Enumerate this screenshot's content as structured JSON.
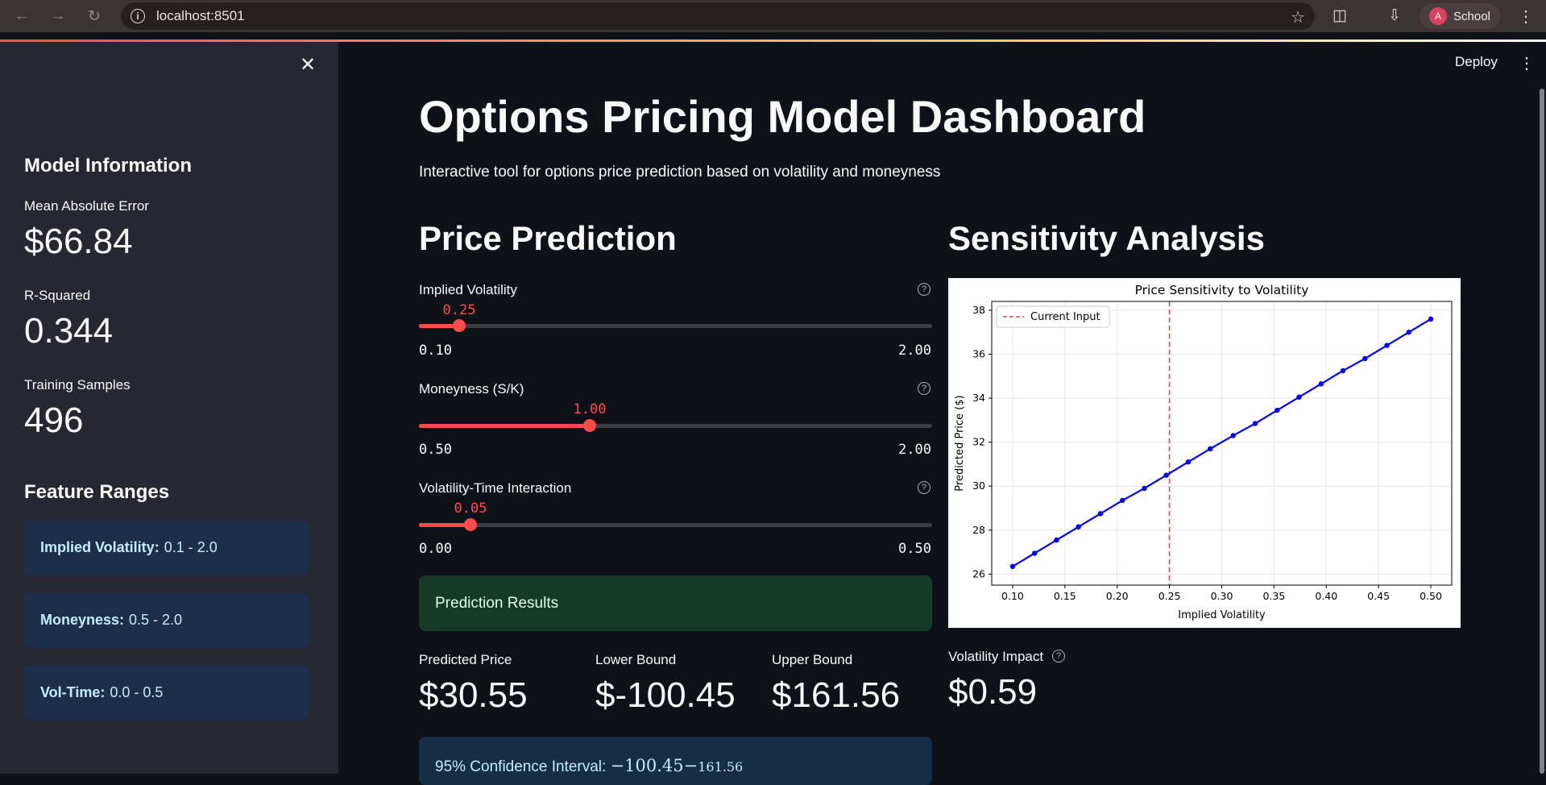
{
  "browser": {
    "url": "localhost:8501",
    "profile_initial": "A",
    "profile_name": "School"
  },
  "header": {
    "deploy_label": "Deploy"
  },
  "sidebar": {
    "model_heading": "Model Information",
    "metrics": [
      {
        "label": "Mean Absolute Error",
        "value": "$66.84"
      },
      {
        "label": "R-Squared",
        "value": "0.344"
      },
      {
        "label": "Training Samples",
        "value": "496"
      }
    ],
    "ranges_heading": "Feature Ranges",
    "ranges": [
      {
        "name": "Implied Volatility:",
        "range": "0.1 - 2.0"
      },
      {
        "name": "Moneyness:",
        "range": "0.5 - 2.0"
      },
      {
        "name": "Vol-Time:",
        "range": "0.0 - 0.5"
      }
    ]
  },
  "main": {
    "title": "Options Pricing Model Dashboard",
    "subtitle": "Interactive tool for options price prediction based on volatility and moneyness",
    "prediction_heading": "Price Prediction",
    "sensitivity_heading": "Sensitivity Analysis",
    "sliders": [
      {
        "label": "Implied Volatility",
        "value": "0.25",
        "min": "0.10",
        "max": "2.00",
        "fraction": 0.0789
      },
      {
        "label": "Moneyness (S/K)",
        "value": "1.00",
        "min": "0.50",
        "max": "2.00",
        "fraction": 0.3333
      },
      {
        "label": "Volatility-Time Interaction",
        "value": "0.05",
        "min": "0.00",
        "max": "0.50",
        "fraction": 0.1
      }
    ],
    "results_label": "Prediction Results",
    "results": [
      {
        "label": "Predicted Price",
        "value": "$30.55"
      },
      {
        "label": "Lower Bound",
        "value": "$-100.45"
      },
      {
        "label": "Upper Bound",
        "value": "$161.56"
      }
    ],
    "ci_label": "95% Confidence Interval:",
    "ci_value": "−100.45−",
    "ci_upper": "161.56",
    "impact_label": "Volatility Impact",
    "impact_value": "$0.59"
  },
  "chart_data": {
    "type": "line",
    "title": "Price Sensitivity to Volatility",
    "xlabel": "Implied Volatility",
    "ylabel": "Predicted Price ($)",
    "xlim": [
      0.08,
      0.52
    ],
    "ylim": [
      25.5,
      38.4
    ],
    "xticks": [
      "0.10",
      "0.15",
      "0.20",
      "0.25",
      "0.30",
      "0.35",
      "0.40",
      "0.45",
      "0.50"
    ],
    "yticks": [
      "26",
      "28",
      "30",
      "32",
      "34",
      "36",
      "38"
    ],
    "grid": true,
    "legend": "top-left",
    "series": [
      {
        "name": "",
        "color": "#0000ff",
        "x": [
          0.1,
          0.121,
          0.142,
          0.163,
          0.184,
          0.205,
          0.226,
          0.247,
          0.268,
          0.289,
          0.311,
          0.332,
          0.353,
          0.374,
          0.395,
          0.416,
          0.437,
          0.458,
          0.479,
          0.5
        ],
        "y": [
          26.35,
          26.95,
          27.55,
          28.15,
          28.75,
          29.35,
          29.9,
          30.5,
          31.1,
          31.7,
          32.3,
          32.85,
          33.45,
          34.05,
          34.65,
          35.25,
          35.8,
          36.4,
          37.0,
          37.6
        ]
      }
    ],
    "reference_line": {
      "name": "Current Input",
      "x": 0.25,
      "color": "#e8453c"
    }
  }
}
